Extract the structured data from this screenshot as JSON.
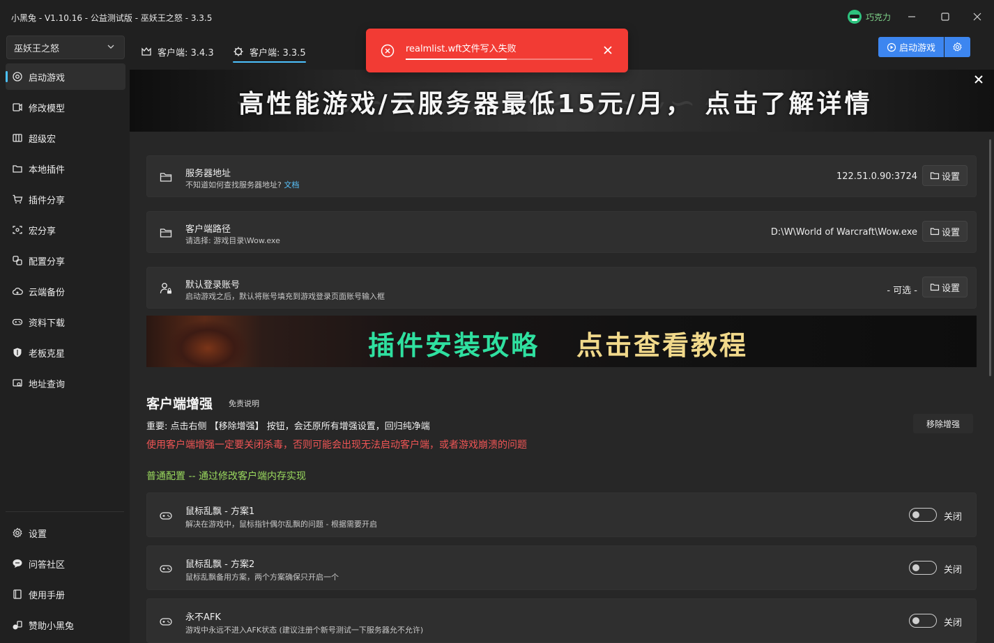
{
  "window": {
    "title": "小黑兔 - V1.10.16 - 公益测试版 - 巫妖王之怒 - 3.3.5",
    "user_name": "巧克力"
  },
  "sidebar": {
    "client_select": "巫妖王之怒",
    "items": [
      {
        "label": "启动游戏",
        "icon": "target-icon"
      },
      {
        "label": "修改模型",
        "icon": "model-icon"
      },
      {
        "label": "超级宏",
        "icon": "macro-icon"
      },
      {
        "label": "本地插件",
        "icon": "folder-icon"
      },
      {
        "label": "插件分享",
        "icon": "cart-icon"
      },
      {
        "label": "宏分享",
        "icon": "share-icon"
      },
      {
        "label": "配置分享",
        "icon": "config-icon"
      },
      {
        "label": "云端备份",
        "icon": "cloud-icon"
      },
      {
        "label": "资料下载",
        "icon": "gamepad-icon"
      },
      {
        "label": "老板克星",
        "icon": "shield-icon"
      },
      {
        "label": "地址查询",
        "icon": "lookup-icon"
      }
    ],
    "bottom_items": [
      {
        "label": "设置",
        "icon": "gear-icon"
      },
      {
        "label": "问答社区",
        "icon": "chat-icon"
      },
      {
        "label": "使用手册",
        "icon": "book-icon"
      },
      {
        "label": "赞助小黑兔",
        "icon": "gift-icon"
      }
    ]
  },
  "tabs": [
    {
      "label": "客户端: 3.4.3",
      "icon": "crown-icon"
    },
    {
      "label": "客户端: 3.3.5",
      "icon": "gear-icon"
    }
  ],
  "toolbar": {
    "launch_label": "启动游戏"
  },
  "toast": {
    "message": "realmlist.wft文件写入失败",
    "progress": 0.54
  },
  "banner_top": {
    "text": "高性能游戏/云服务器最低15元/月， 点击了解详情"
  },
  "settings": [
    {
      "title": "服务器地址",
      "subtitle": "不知道如何查找服务器地址?",
      "link": "文档",
      "value": "122.51.0.90:3724",
      "button": "设置"
    },
    {
      "title": "客户端路径",
      "subtitle": "请选择: 游戏目录\\Wow.exe",
      "value": "D:\\W\\World of Warcraft\\Wow.exe",
      "button": "设置"
    },
    {
      "title": "默认登录账号",
      "subtitle": "启动游戏之后，默认将账号填充到游戏登录页面账号输入框",
      "value": "- 可选 -",
      "button": "设置"
    }
  ],
  "banner_mid": {
    "part1": "插件安装攻略",
    "part2": "点击查看教程"
  },
  "enhance": {
    "title": "客户端增强",
    "disclaimer": "免责说明",
    "important": "重要: 点击右侧 【移除增强】 按钮，会还原所有增强设置，回归纯净端",
    "remove_button": "移除增强",
    "warning": "使用客户端增强一定要关闭杀毒，否则可能会出现无法启动客户端，或者游戏崩溃的问题",
    "subsection": "普通配置 -- 通过修改客户端内存实现",
    "options": [
      {
        "title": "鼠标乱飘 - 方案1",
        "subtitle": "解决在游戏中，鼠标指针偶尔乱飘的问题 - 根据需要开启",
        "state": "关闭",
        "on": false
      },
      {
        "title": "鼠标乱飘 - 方案2",
        "subtitle": "鼠标乱飘备用方案，两个方案确保只开启一个",
        "state": "关闭",
        "on": false
      },
      {
        "title": "永不AFK",
        "subtitle": "游戏中永远不进入AFK状态 (建议注册个新号测试一下服务器允不允许)",
        "state": "关闭",
        "on": false
      }
    ]
  },
  "colors": {
    "accent": "#4cc2ff",
    "primary_button": "#3d86f0",
    "toast_error": "#f23b34",
    "warning_text": "#f05555",
    "subsection_text": "#9ad95e"
  }
}
